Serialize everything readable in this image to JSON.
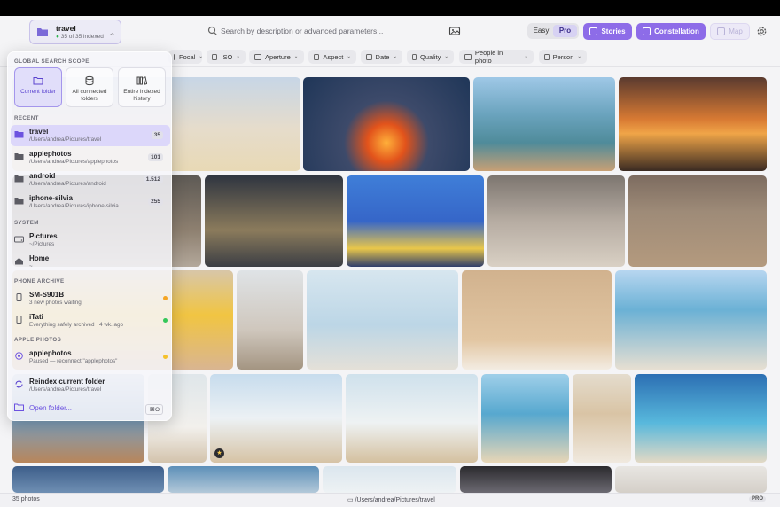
{
  "header": {
    "folder": {
      "name": "travel",
      "status_dot": "●",
      "count_text": "35 of 35 indexed"
    },
    "search_placeholder": "Search by description or advanced parameters...",
    "mode": {
      "easy": "Easy",
      "pro": "Pro",
      "selected": "Pro"
    },
    "buttons": {
      "stories": "Stories",
      "constellation": "Constellation",
      "map": "Map"
    }
  },
  "filters": [
    "Focal",
    "ISO",
    "Aperture",
    "Aspect",
    "Date",
    "Quality",
    "People in photo",
    "Person"
  ],
  "popover": {
    "scope_title": "GLOBAL SEARCH SCOPE",
    "scopes": [
      "Current folder",
      "All connected folders",
      "Entire indexed history"
    ],
    "recent_title": "RECENT",
    "recent": [
      {
        "name": "travel",
        "path": "/Users/andrea/Pictures/travel",
        "count": "35"
      },
      {
        "name": "applephotos",
        "path": "/Users/andrea/Pictures/applephotos",
        "count": "101"
      },
      {
        "name": "android",
        "path": "/Users/andrea/Pictures/android",
        "count": "1.512"
      },
      {
        "name": "iphone-silvia",
        "path": "/Users/andrea/Pictures/iphone-silvia",
        "count": "255"
      }
    ],
    "system_title": "SYSTEM",
    "system": [
      {
        "name": "Pictures",
        "path": "~/Pictures"
      },
      {
        "name": "Home",
        "path": "~"
      }
    ],
    "phone_title": "PHONE ARCHIVE",
    "phone": [
      {
        "name": "SM-S901B",
        "path": "3 new photos waiting",
        "dot_color": "#f5a524"
      },
      {
        "name": "iTati",
        "path": "Everything safely archived · 4 wk. ago",
        "dot_color": "#34c759"
      }
    ],
    "apple_title": "APPLE PHOTOS",
    "apple": [
      {
        "name": "applephotos",
        "path": "Paused — reconnect \"applephotos\"",
        "dot_color": "#f5c12a"
      }
    ],
    "reindex": {
      "name": "Reindex current folder",
      "path": "/Users/andrea/Pictures/travel"
    },
    "open": {
      "name": "Open folder...",
      "shortcut": "⌘O"
    }
  },
  "status": {
    "count": "35 photos",
    "path": "/Users/andrea/Pictures/travel",
    "badge": "PRO"
  },
  "colors": {
    "accent": "#8d6ce8",
    "selected_bg": "#dad5fa"
  }
}
